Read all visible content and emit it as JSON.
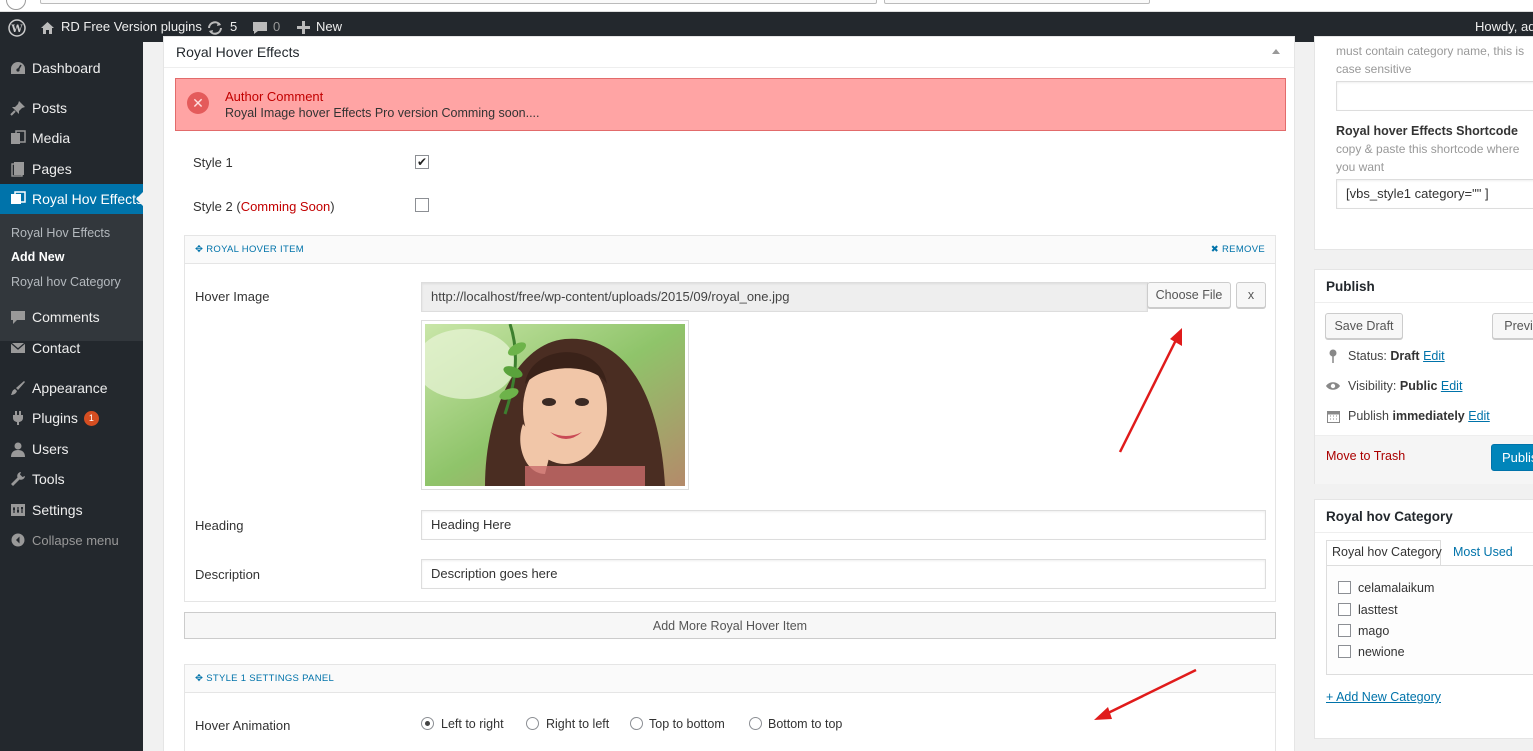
{
  "adminbar": {
    "site_name": "RD Free Version plugins",
    "updates_count": "5",
    "comments_count": "0",
    "new_label": "New",
    "howdy": "Howdy, ad"
  },
  "sidebar": {
    "items": [
      {
        "label": "Dashboard",
        "icon": "dashboard-icon"
      },
      {
        "label": "Posts",
        "icon": "pin-icon"
      },
      {
        "label": "Media",
        "icon": "media-icon"
      },
      {
        "label": "Pages",
        "icon": "pages-icon"
      },
      {
        "label": "Royal Hov Effects",
        "icon": "royal-hover-icon"
      },
      {
        "label": "Comments",
        "icon": "comment-icon"
      },
      {
        "label": "Contact",
        "icon": "mail-icon"
      },
      {
        "label": "Appearance",
        "icon": "brush-icon"
      },
      {
        "label": "Plugins",
        "icon": "plugin-icon",
        "badge": "1"
      },
      {
        "label": "Users",
        "icon": "user-icon"
      },
      {
        "label": "Tools",
        "icon": "wrench-icon"
      },
      {
        "label": "Settings",
        "icon": "settings-icon"
      }
    ],
    "submenu": [
      "Royal Hov Effects",
      "Add New",
      "Royal hov Category"
    ],
    "collapse_label": "Collapse menu"
  },
  "metabox": {
    "title": "Royal Hover Effects",
    "notice": {
      "title": "Author Comment",
      "text": "Royal Image hover Effects Pro version Comming soon...."
    },
    "style1_label": "Style 1",
    "style1_checked": true,
    "style2_label": "Style 2 (",
    "style2_soon": "Comming Soon",
    "style2_close": ")",
    "style2_checked": false,
    "item_panel": {
      "title": "ROYAL HOVER ITEM",
      "remove_label": "REMOVE",
      "hover_image_label": "Hover Image",
      "image_url": "http://localhost/free/wp-content/uploads/2015/09/royal_one.jpg",
      "choose_file_label": "Choose File",
      "clear_label": "x",
      "heading_label": "Heading",
      "heading_value": "Heading Here",
      "description_label": "Description",
      "description_value": "Description goes here"
    },
    "add_more_label": "Add More Royal Hover Item",
    "settings_panel": {
      "title": "STYLE 1 SETTINGS PANEL",
      "hover_animation_label": "Hover Animation",
      "options": [
        "Left to right",
        "Right to left",
        "Top to bottom",
        "Bottom to top"
      ],
      "selected": "Left to right"
    }
  },
  "right_sidebar": {
    "category_hint": [
      "must contain category name, this is",
      "case sensitive"
    ],
    "shortcode_title": "Royal hover Effects Shortcode",
    "shortcode_hint": [
      "copy & paste this shortcode where",
      "you want"
    ],
    "shortcode_value": "[vbs_style1 category=\"\" ]",
    "publish": {
      "title": "Publish",
      "save_draft": "Save Draft",
      "preview": "Previe",
      "status_label": "Status:",
      "status_value": "Draft",
      "visibility_label": "Visibility:",
      "visibility_value": "Public",
      "publish_label": "Publish",
      "publish_value": "immediately",
      "edit_label": "Edit",
      "trash_label": "Move to Trash",
      "publish_button": "Publis"
    },
    "category": {
      "title": "Royal hov Category",
      "tab_all": "Royal hov Category",
      "tab_most_used": "Most Used",
      "items": [
        "celamalaikum",
        "lasttest",
        "mago",
        "newione"
      ],
      "add_new": "+ Add New Category"
    }
  },
  "colors": {
    "adminbar_bg": "#23282d",
    "accent": "#0073aa",
    "notice_bg": "#ffa4a4",
    "notice_title": "#c20000",
    "annotation_arrow": "#e01b1b"
  }
}
